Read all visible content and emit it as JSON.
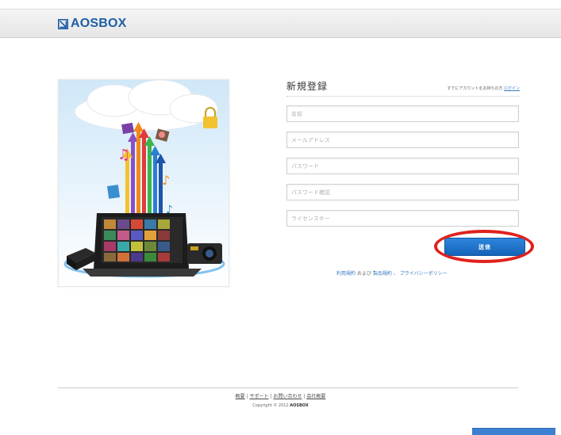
{
  "header": {
    "logo_text": "AOSBOX",
    "brand_color": "#1d5fa6"
  },
  "hero": {
    "image_desc_icon": "cloud-upload-illustration"
  },
  "form": {
    "title": "新規登録",
    "login_prefix": "すでにアカウントをお持ちの方",
    "login_link": "ログイン",
    "fields": [
      {
        "placeholder": "名前",
        "value": ""
      },
      {
        "placeholder": "メールアドレス",
        "value": ""
      },
      {
        "placeholder": "パスワード",
        "value": ""
      },
      {
        "placeholder": "パスワード確認",
        "value": ""
      },
      {
        "placeholder": "ライセンスキー",
        "value": ""
      }
    ],
    "submit_label": "送信",
    "highlight_color": "#e0211d"
  },
  "terms": {
    "link1": "利用規約",
    "and": "および",
    "link2": "製品規約",
    "sep": "、",
    "link3": "プライバシーポリシー"
  },
  "footer": {
    "links": [
      "概要",
      "サポート",
      "お問い合わせ",
      "会社概要"
    ],
    "separator": "|",
    "copyright_prefix": "Copyright © 2012",
    "copyright_brand": "AOSBOX"
  }
}
